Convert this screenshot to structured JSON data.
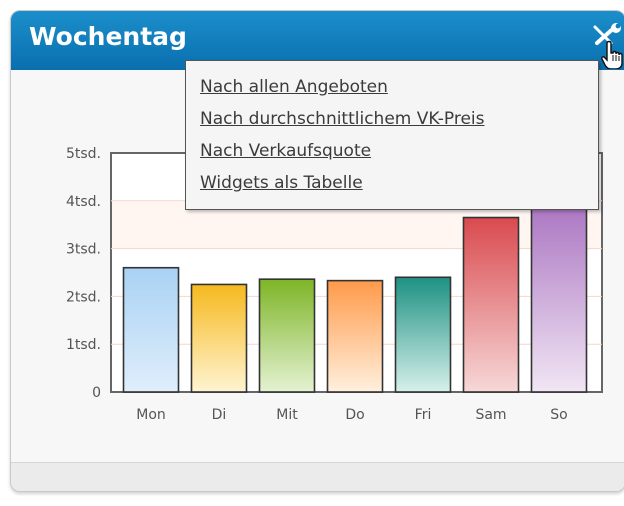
{
  "widget": {
    "title": "Wochentag",
    "tool_icon": "wrench-icon",
    "cursor_icon": "hand-pointer-icon"
  },
  "menu": {
    "items": [
      {
        "label": "Nach allen Angeboten"
      },
      {
        "label": "Nach durchschnittlichem VK-Preis"
      },
      {
        "label": "Nach Verkaufsquote"
      },
      {
        "label": "Widgets als Tabelle"
      }
    ]
  },
  "colors": {
    "header": "#0a78b8",
    "bars": [
      [
        "#dfeefb",
        "#a9d2f4"
      ],
      [
        "#fff4d2",
        "#f6b91e"
      ],
      [
        "#e5f2d3",
        "#7db526"
      ],
      [
        "#fff0de",
        "#ff9a4a"
      ],
      [
        "#d6f0ea",
        "#1e9183"
      ],
      [
        "#f7d8d8",
        "#d94a4f"
      ],
      [
        "#f1e6f4",
        "#a46bbd"
      ]
    ]
  },
  "chart_data": {
    "type": "bar",
    "categories": [
      "Mon",
      "Di",
      "Mit",
      "Do",
      "Fri",
      "Sam",
      "So"
    ],
    "values": [
      2600,
      2250,
      2360,
      2330,
      2400,
      3650,
      4300
    ],
    "ylim": [
      0,
      5000
    ],
    "yticks": [
      {
        "value": 0,
        "label": "0"
      },
      {
        "value": 1000,
        "label": "1tsd."
      },
      {
        "value": 2000,
        "label": "2tsd."
      },
      {
        "value": 3000,
        "label": "3tsd."
      },
      {
        "value": 4000,
        "label": "4tsd."
      },
      {
        "value": 5000,
        "label": "5tsd."
      }
    ],
    "grid": true
  }
}
